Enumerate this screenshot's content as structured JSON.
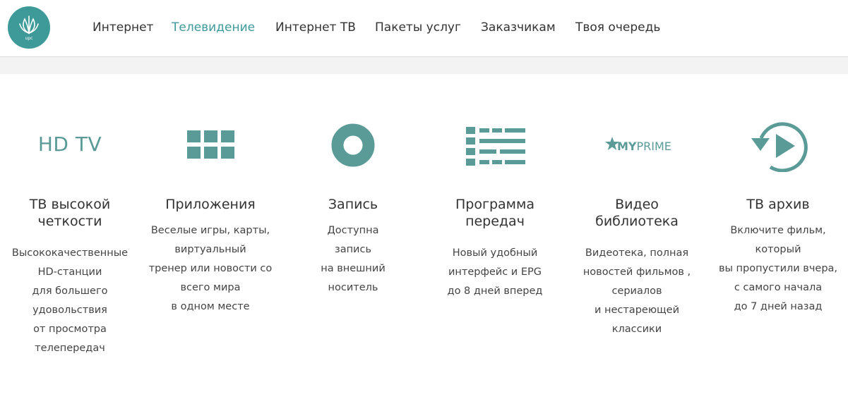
{
  "brand": {
    "logo_text": "upc",
    "accent": "#3d9a98",
    "icon_color": "#5b9b97"
  },
  "nav": {
    "items": [
      {
        "label": "Интернет",
        "active": false
      },
      {
        "label": "Телевидение",
        "active": true
      },
      {
        "label": "Интернет ТВ",
        "active": false
      },
      {
        "label": "Пакеты услуг",
        "active": false
      },
      {
        "label": "Заказчикам",
        "active": false
      },
      {
        "label": "Твоя очередь",
        "active": false
      }
    ]
  },
  "features": [
    {
      "icon": "hd-tv-icon",
      "icon_text": "HD TV",
      "title": "ТВ высокой\nчеткости",
      "description": "Высококачественные\nHD-станции\nдля большего\nудовольствия\nот просмотра\nтелепередач"
    },
    {
      "icon": "apps-grid-icon",
      "title": "Приложения",
      "description": "Веселые игры, карты,\nвиртуальный\nтренер или новости со\nвсего мира\nв одном месте"
    },
    {
      "icon": "record-icon",
      "title": "Запись",
      "description": "Доступна\nзапись\nна внешний\nноситель"
    },
    {
      "icon": "program-guide-icon",
      "title": "Программа\nпередач",
      "description": "Новый удобный\nинтерфейс и EPG\nдо 8 дней вперед"
    },
    {
      "icon": "myprime-icon",
      "icon_text_bold": "MY",
      "icon_text_light": "PRIME",
      "title": "Видео\nбиблиотека",
      "description": "Видеотека, полная\nновостей фильмов ,\nсериалов\nи нестареющей\nклассики"
    },
    {
      "icon": "replay-icon",
      "title": "ТВ архив",
      "description": "Включите фильм,\nкоторый\nвы пропустили вчера,\nс самого начала\nдо 7 дней назад"
    }
  ]
}
